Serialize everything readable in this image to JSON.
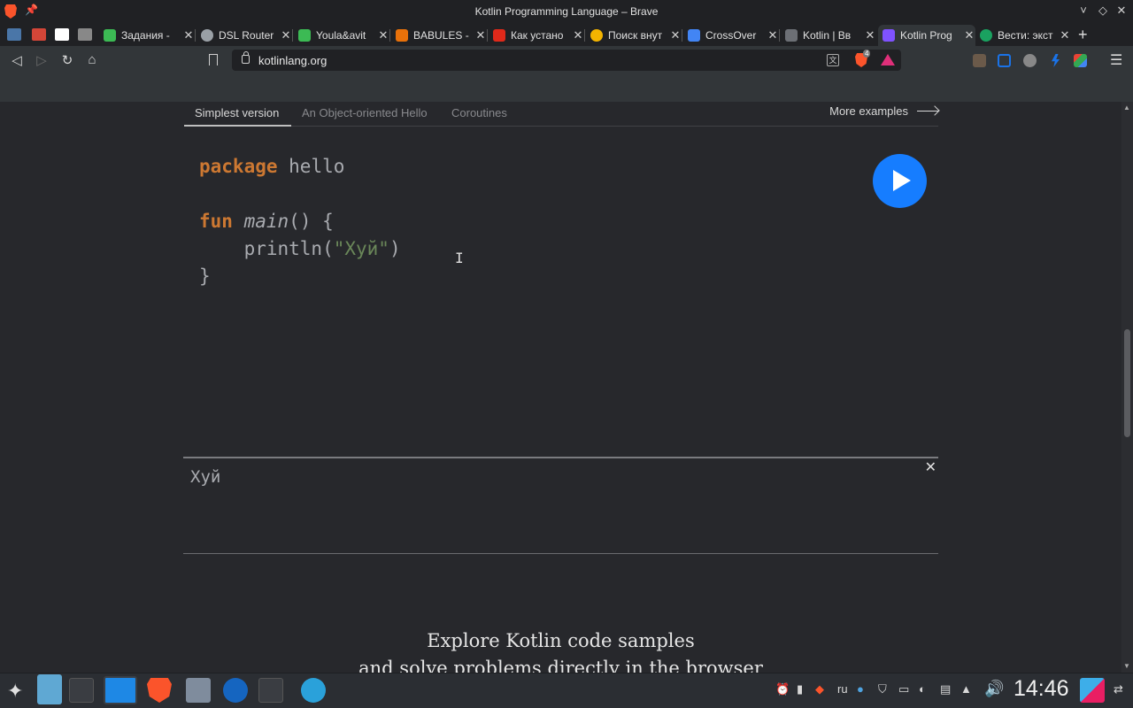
{
  "window": {
    "title": "Kotlin Programming Language – Brave",
    "controls": [
      "˅",
      "◇",
      "✕"
    ]
  },
  "pinned_tabs": [
    {
      "icon": "vk-icon",
      "color": "#4a76a8"
    },
    {
      "icon": "gmail-icon",
      "color": "#d44638"
    },
    {
      "icon": "notion-icon",
      "color": "#ffffff"
    },
    {
      "icon": "grid-icon",
      "color": "#888888"
    }
  ],
  "tabs": [
    {
      "label": "Задания - ",
      "icon": "cube-icon",
      "color": "#3cba54"
    },
    {
      "label": "DSL Router",
      "icon": "router-icon",
      "color": "#9aa0a6"
    },
    {
      "label": "Youla&avit",
      "icon": "chart-icon",
      "color": "#3cba54"
    },
    {
      "label": "BABULES - ",
      "icon": "babules-icon",
      "color": "#e8710a"
    },
    {
      "label": "Как устано",
      "icon": "adobe-icon",
      "color": "#e0291a"
    },
    {
      "label": "Поиск внут",
      "icon": "coin-icon",
      "color": "#f4b400"
    },
    {
      "label": "CrossOver ",
      "icon": "crossover-icon",
      "color": "#4285f4"
    },
    {
      "label": "Kotlin | Вв",
      "icon": "mail-icon",
      "color": "#6c6f75"
    },
    {
      "label": "Kotlin Prog",
      "icon": "kotlin-icon",
      "color": "#7f52ff",
      "active": true
    },
    {
      "label": "Вести: экст",
      "icon": "check-icon",
      "color": "#1aa260"
    }
  ],
  "toolbar": {
    "url": "kotlinlang.org",
    "shield_count": "4",
    "translate_glyph": "文"
  },
  "page": {
    "subtabs": [
      "Simplest version",
      "An Object-oriented Hello",
      "Coroutines"
    ],
    "more_examples": "More examples",
    "code": {
      "l1_kw": "package",
      "l1_rest": " hello",
      "l3_kw": "fun",
      "l3_space": " ",
      "l3_fn": "main",
      "l3_rest": "() {",
      "l4_pre": "    println(",
      "l4_str": "\"Хуй\"",
      "l4_post": ")",
      "l5": "}"
    },
    "output": "Хуй",
    "output_close": "✕",
    "explore_line1": "Explore Kotlin code samples",
    "explore_line2": "and solve problems directly in the browser"
  },
  "taskbar": {
    "tray_lang": "ru",
    "clock": "14:46"
  },
  "colors": {
    "accent_play": "#167dff",
    "keyword": "#cc7832",
    "string": "#6a8759"
  }
}
